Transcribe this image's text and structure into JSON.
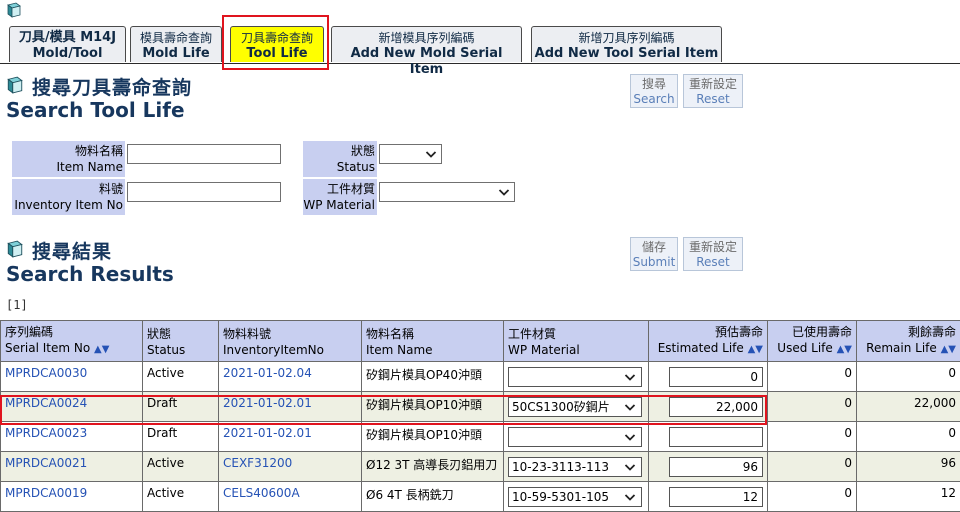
{
  "tabs": [
    {
      "zh": "刀具/模具 M14J",
      "en": "Mold/Tool"
    },
    {
      "zh": "模具壽命查詢",
      "en": "Mold Life"
    },
    {
      "zh": "刀具壽命查詢",
      "en": "Tool Life"
    },
    {
      "zh": "新增模具序列編碼",
      "en": "Add New Mold Serial Item"
    },
    {
      "zh": "新增刀具序列編碼",
      "en": "Add New Tool Serial Item"
    }
  ],
  "search": {
    "title_zh": "搜尋刀具壽命查詢",
    "title_en": "Search Tool Life",
    "search_button": {
      "zh": "搜尋",
      "en": "Search"
    },
    "reset_button": {
      "zh": "重新設定",
      "en": "Reset"
    },
    "item_name": {
      "zh": "物料名稱",
      "en": "Item Name",
      "value": ""
    },
    "inventory_no": {
      "zh": "料號",
      "en": "Inventory Item No",
      "value": ""
    },
    "status": {
      "zh": "狀態",
      "en": "Status",
      "value": ""
    },
    "wp_material": {
      "zh": "工件材質",
      "en": "WP Material",
      "value": ""
    }
  },
  "results": {
    "title_zh": "搜尋結果",
    "title_en": "Search Results",
    "submit_button": {
      "zh": "儲存",
      "en": "Submit"
    },
    "reset_button": {
      "zh": "重新設定",
      "en": "Reset"
    },
    "pager": "[1]",
    "sort_glyph": "▲▼",
    "columns": [
      {
        "zh": "序列編碼",
        "en": "Serial Item No"
      },
      {
        "zh": "狀態",
        "en": "Status"
      },
      {
        "zh": "物料料號",
        "en": "InventoryItemNo"
      },
      {
        "zh": "物料名稱",
        "en": "Item Name"
      },
      {
        "zh": "工件材質",
        "en": "WP Material"
      },
      {
        "zh": "預估壽命",
        "en": "Estimated Life"
      },
      {
        "zh": "已使用壽命",
        "en": "Used Life"
      },
      {
        "zh": "剩餘壽命",
        "en": "Remain Life"
      }
    ],
    "rows": [
      {
        "serial": "MPRDCA0030",
        "status": "Active",
        "inv": "2021-01-02.04",
        "name": "矽鋼片模具OP40沖頭",
        "wp": "",
        "est": "0",
        "used": "0",
        "remain": "0"
      },
      {
        "serial": "MPRDCA0024",
        "status": "Draft",
        "inv": "2021-01-02.01",
        "name": "矽鋼片模具OP10沖頭",
        "wp": "50CS1300矽鋼片",
        "est": "22,000",
        "used": "0",
        "remain": "22,000"
      },
      {
        "serial": "MPRDCA0023",
        "status": "Draft",
        "inv": "2021-01-02.01",
        "name": "矽鋼片模具OP10沖頭",
        "wp": "",
        "est": "",
        "used": "0",
        "remain": "0"
      },
      {
        "serial": "MPRDCA0021",
        "status": "Active",
        "inv": "CEXF31200",
        "name": "Ø12 3T 高導長刃鋁用刀",
        "wp": "10-23-3113-113",
        "est": "96",
        "used": "0",
        "remain": "96"
      },
      {
        "serial": "MPRDCA0019",
        "status": "Active",
        "inv": "CELS40600A",
        "name": "Ø6 4T 長柄銑刀",
        "wp": "10-59-5301-105",
        "est": "12",
        "used": "0",
        "remain": "12"
      }
    ]
  },
  "colors": {
    "highlight": "#e0141e",
    "active_tab": "#ffff00",
    "header_bg": "#c8cff0",
    "link": "#2552b5",
    "title": "#17375e"
  }
}
